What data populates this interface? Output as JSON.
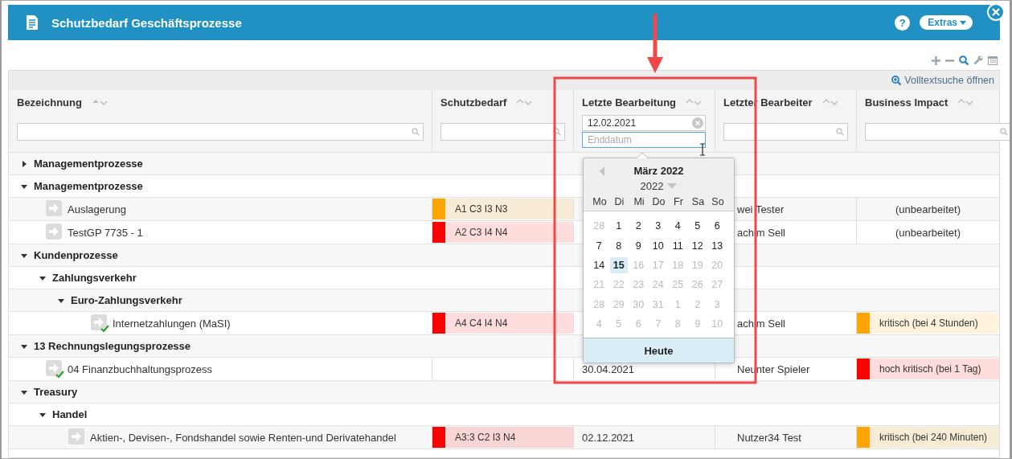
{
  "window": {
    "title": "Schutzbedarf Geschäftsprozesse",
    "help_button": "?",
    "extras_button": "Extras"
  },
  "toolbar": {
    "fulltext_link": "Volltextsuche öffnen"
  },
  "table": {
    "columns": [
      {
        "title": "Bezeichnung",
        "sorted": true,
        "filter": {
          "kind": "search"
        }
      },
      {
        "title": "Schutzbedarf",
        "sorted": false,
        "filter": {
          "kind": "search"
        }
      },
      {
        "title": "Letzte Bearbeitung",
        "sorted": false,
        "filter": {
          "kind": "date_range",
          "value": "12.02.2021",
          "placeholder": "Enddatum"
        }
      },
      {
        "title": "Letzter Bearbeiter",
        "sorted": false,
        "filter": {
          "kind": "search"
        }
      },
      {
        "title": "Business Impact",
        "sorted": false,
        "filter": {
          "kind": "search"
        }
      }
    ],
    "rows": [
      {
        "kind": "group",
        "label": "Managementprozesse",
        "expanded": false
      },
      {
        "kind": "group",
        "label": "Managementprozesse",
        "expanded": true,
        "children": [
          {
            "kind": "process",
            "label": "Auslagerung",
            "approved": false,
            "protection": {
              "text": "A1 C3 I3 N3",
              "color": "#ffa500"
            },
            "editor": "wei Tester",
            "impact": {
              "text": "(unbearbeitet)"
            }
          },
          {
            "kind": "process",
            "label": "TestGP 7735 - 1",
            "approved": false,
            "protection": {
              "text": "A2 C3 I4 N4",
              "color": "#ff0000"
            },
            "editor": "achim Sell",
            "impact": {
              "text": "(unbearbeitet)"
            }
          }
        ]
      },
      {
        "kind": "group",
        "label": "Kundenprozesse",
        "expanded": true,
        "children": [
          {
            "kind": "group",
            "label": "Zahlungsverkehr",
            "expanded": true,
            "children": [
              {
                "kind": "group",
                "label": "Euro-Zahlungsverkehr",
                "expanded": true,
                "children": [
                  {
                    "kind": "process",
                    "label": "Internetzahlungen (MaSI)",
                    "approved": true,
                    "protection": {
                      "text": "A4 C4 I4 N4",
                      "color": "#ff0000"
                    },
                    "editor": "achim Sell",
                    "impact": {
                      "text": "kritisch (bei 4 Stunden)",
                      "color": "#ffa500"
                    }
                  }
                ]
              }
            ]
          }
        ]
      },
      {
        "kind": "group",
        "label": "13 Rechnungslegungsprozesse",
        "expanded": true,
        "children": [
          {
            "kind": "process",
            "label": "04 Finanzbuchhaltungsprozess",
            "approved": true,
            "date": "30.04.2021",
            "editor": "Neunter Spieler",
            "impact": {
              "text": "hoch kritisch (bei 1 Tag)",
              "color": "#ff0000"
            }
          }
        ]
      },
      {
        "kind": "group",
        "label": "Treasury",
        "expanded": true,
        "children": [
          {
            "kind": "group",
            "label": "Handel",
            "expanded": true,
            "children": [
              {
                "kind": "process",
                "label": "Aktien-, Devisen-, Fondshandel sowie Renten-und Derivatehandel",
                "approved": false,
                "protection": {
                  "text": "A3:3 C2 I3 N4",
                  "color": "#ff0000"
                },
                "date": "02.12.2021",
                "editor": "Nutzer34 Test",
                "impact": {
                  "text": "kritisch (bei 240 Minuten)",
                  "color": "#ffa500"
                }
              }
            ]
          }
        ]
      }
    ]
  },
  "date_picker": {
    "title": "März 2022",
    "year": "2022",
    "weekdays": [
      "Mo",
      "Di",
      "Mi",
      "Do",
      "Fr",
      "Sa",
      "So"
    ],
    "weeks": [
      [
        {
          "day": "28",
          "muted": true,
          "selected": false
        },
        {
          "day": "1",
          "muted": false,
          "selected": false
        },
        {
          "day": "2",
          "muted": false,
          "selected": false
        },
        {
          "day": "3",
          "muted": false,
          "selected": false
        },
        {
          "day": "4",
          "muted": false,
          "selected": false
        },
        {
          "day": "5",
          "muted": false,
          "selected": false
        },
        {
          "day": "6",
          "muted": false,
          "selected": false
        }
      ],
      [
        {
          "day": "7",
          "muted": false,
          "selected": false
        },
        {
          "day": "8",
          "muted": false,
          "selected": false
        },
        {
          "day": "9",
          "muted": false,
          "selected": false
        },
        {
          "day": "10",
          "muted": false,
          "selected": false
        },
        {
          "day": "11",
          "muted": false,
          "selected": false
        },
        {
          "day": "12",
          "muted": false,
          "selected": false
        },
        {
          "day": "13",
          "muted": false,
          "selected": false
        }
      ],
      [
        {
          "day": "14",
          "muted": false,
          "selected": false
        },
        {
          "day": "15",
          "muted": false,
          "selected": true
        },
        {
          "day": "16",
          "muted": true,
          "selected": false
        },
        {
          "day": "17",
          "muted": true,
          "selected": false
        },
        {
          "day": "18",
          "muted": true,
          "selected": false
        },
        {
          "day": "19",
          "muted": true,
          "selected": false
        },
        {
          "day": "20",
          "muted": true,
          "selected": false
        }
      ],
      [
        {
          "day": "21",
          "muted": true,
          "selected": false
        },
        {
          "day": "22",
          "muted": true,
          "selected": false
        },
        {
          "day": "23",
          "muted": true,
          "selected": false
        },
        {
          "day": "24",
          "muted": true,
          "selected": false
        },
        {
          "day": "25",
          "muted": true,
          "selected": false
        },
        {
          "day": "26",
          "muted": true,
          "selected": false
        },
        {
          "day": "27",
          "muted": true,
          "selected": false
        }
      ],
      [
        {
          "day": "28",
          "muted": true,
          "selected": false
        },
        {
          "day": "29",
          "muted": true,
          "selected": false
        },
        {
          "day": "30",
          "muted": true,
          "selected": false
        },
        {
          "day": "31",
          "muted": true,
          "selected": false
        },
        {
          "day": "1",
          "muted": true,
          "selected": false
        },
        {
          "day": "2",
          "muted": true,
          "selected": false
        },
        {
          "day": "3",
          "muted": true,
          "selected": false
        }
      ],
      [
        {
          "day": "4",
          "muted": true,
          "selected": false
        },
        {
          "day": "5",
          "muted": true,
          "selected": false
        },
        {
          "day": "6",
          "muted": true,
          "selected": false
        },
        {
          "day": "7",
          "muted": true,
          "selected": false
        },
        {
          "day": "8",
          "muted": true,
          "selected": false
        },
        {
          "day": "9",
          "muted": true,
          "selected": false
        },
        {
          "day": "10",
          "muted": true,
          "selected": false
        }
      ]
    ],
    "today_button": "Heute"
  }
}
